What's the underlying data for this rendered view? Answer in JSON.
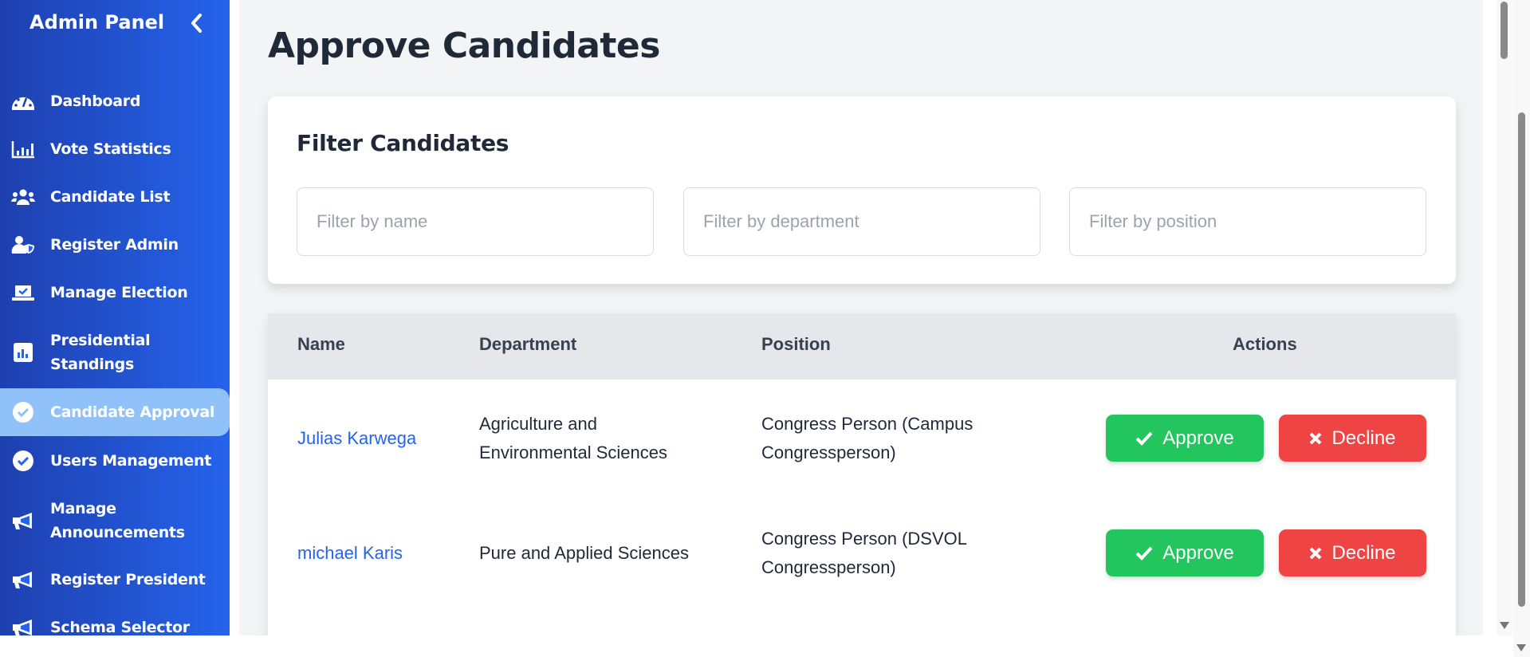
{
  "sidebar": {
    "title": "Admin Panel",
    "items": [
      {
        "label": "Dashboard",
        "icon": "gauge-icon"
      },
      {
        "label": "Vote Statistics",
        "icon": "bar-chart-icon"
      },
      {
        "label": "Candidate List",
        "icon": "users-icon"
      },
      {
        "label": "Register Admin",
        "icon": "user-shield-icon"
      },
      {
        "label": "Manage Election",
        "icon": "laptop-check-icon"
      },
      {
        "label": "Presidential Standings",
        "icon": "chart-square-icon"
      },
      {
        "label": "Candidate Approval",
        "icon": "check-circle-icon",
        "active": true
      },
      {
        "label": "Users Management",
        "icon": "check-circle-icon"
      },
      {
        "label": "Manage Announcements",
        "icon": "megaphone-icon"
      },
      {
        "label": "Register President",
        "icon": "megaphone-icon"
      },
      {
        "label": "Schema Selector",
        "icon": "megaphone-icon"
      }
    ]
  },
  "main": {
    "title": "Approve Candidates",
    "filter": {
      "heading": "Filter Candidates",
      "name_placeholder": "Filter by name",
      "department_placeholder": "Filter by department",
      "position_placeholder": "Filter by position"
    },
    "table": {
      "headers": {
        "name": "Name",
        "department": "Department",
        "position": "Position",
        "actions": "Actions"
      },
      "rows": [
        {
          "name": "Julias Karwega",
          "department": [
            "Agriculture and",
            "Environmental Sciences"
          ],
          "position": [
            "Congress Person (Campus",
            "Congressperson)"
          ]
        },
        {
          "name": "michael Karis",
          "department": [
            "Pure and Applied Sciences"
          ],
          "position": [
            "Congress Person (DSVOL",
            "Congressperson)"
          ]
        }
      ],
      "approve_label": "Approve",
      "decline_label": "Decline"
    }
  },
  "colors": {
    "sidebar_start": "#1e40af",
    "sidebar_end": "#2563eb",
    "active": "#90c2f9",
    "approve": "#22c55e",
    "decline": "#ef4444",
    "link": "#2563eb"
  }
}
